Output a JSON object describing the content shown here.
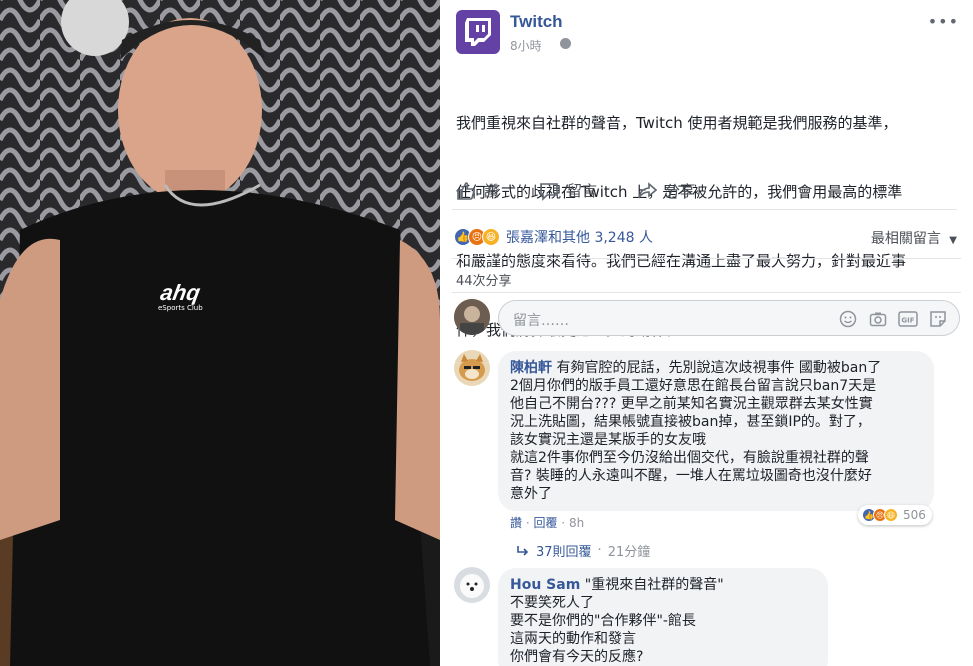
{
  "post": {
    "page_name": "Twitch",
    "time": "8小時",
    "text_lines": [
      "我們重視來自社群的聲音，Twitch 使用者規範是我們服務的基準，",
      "任何形式的歧視在 Twitch 上，是不被允許的，我們會用最高的標準",
      "和嚴謹的態度來看待。我們已經在溝通上盡了最大努力，針對最近事",
      "件，我們將採取更進一步的動作。"
    ],
    "photo_logo": "ahq",
    "photo_logo_sub": "eSports Club"
  },
  "actions": {
    "like": "讚",
    "comment": "留言",
    "share": "分享"
  },
  "reactions": {
    "summary": "張嘉澤和其他 3,248 人",
    "sort_label": "最相關留言"
  },
  "shares": "44次分享",
  "comment_input": {
    "placeholder": "留言……"
  },
  "comments": [
    {
      "author": "陳柏軒",
      "lines": [
        "有夠官腔的屁話，先別說這次歧視事件 國動被ban了",
        "2個月你們的版手員工還好意思在館長台留言說只ban7天是",
        "他自己不開台??? 更早之前某知名實況主觀眾群去某女性實",
        "況上洗貼圖，結果帳號直接被ban掉，甚至鎖IP的。對了，",
        "該女實況主還是某版手的女友哦",
        "就這2件事你們至今仍沒給出個交代，有臉說重視社群的聲",
        "音? 裝睡的人永遠叫不醒，一堆人在罵垃圾圖奇也沒什麼好",
        "意外了"
      ],
      "like": "讚",
      "reply": "回覆",
      "time": "8h",
      "reaction_count": "506",
      "replies": "37則回覆",
      "replies_time": "21分鐘"
    },
    {
      "author": "Hou Sam",
      "lines": [
        "\"重視來自社群的聲音\"",
        "不要笑死人了",
        "要不是你們的\"合作夥伴\"-館長",
        "這兩天的動作和發言",
        "你們會有今天的反應?"
      ]
    }
  ],
  "colors": {
    "link": "#365899",
    "twitch": "#6441a4",
    "meta": "#90949c",
    "bubble": "#f2f3f5"
  }
}
